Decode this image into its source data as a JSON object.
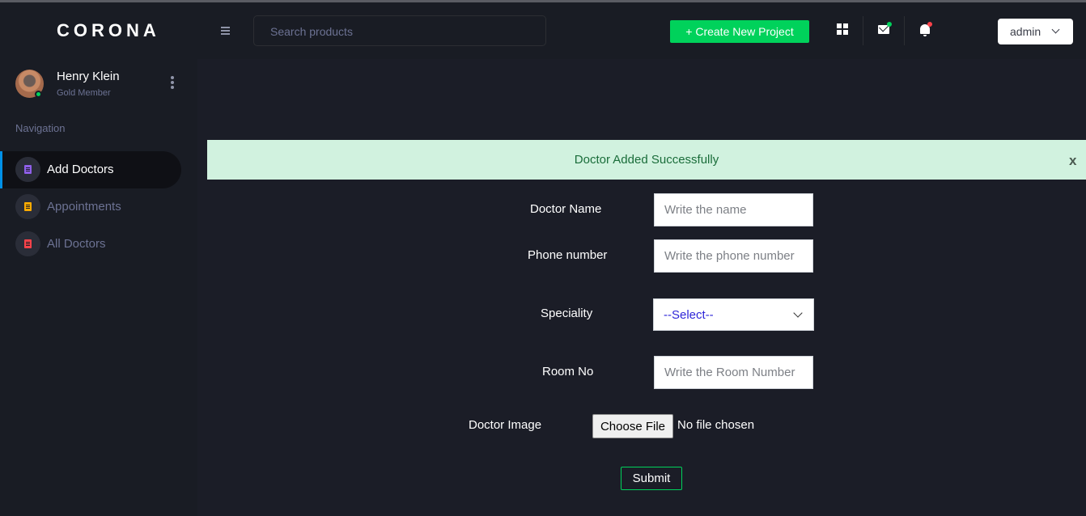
{
  "brand": "CORONA",
  "profile": {
    "name": "Henry Klein",
    "role": "Gold Member"
  },
  "sidebar": {
    "heading": "Navigation",
    "items": [
      {
        "label": "Add Doctors",
        "icon": "document-icon",
        "icon_color": "#8f5fe8",
        "active": true
      },
      {
        "label": "Appointments",
        "icon": "document-icon",
        "icon_color": "#ffab00",
        "active": false
      },
      {
        "label": "All Doctors",
        "icon": "document-icon",
        "icon_color": "#fc424a",
        "active": false
      }
    ]
  },
  "header": {
    "search_placeholder": "Search products",
    "create_button": "+ Create New Project",
    "user_menu": "admin"
  },
  "alert": {
    "message": "Doctor Added Successfully",
    "close": "x"
  },
  "form": {
    "doctor_name": {
      "label": "Doctor Name",
      "placeholder": "Write the name"
    },
    "phone": {
      "label": "Phone number",
      "placeholder": "Write the phone number"
    },
    "speciality": {
      "label": "Speciality",
      "selected": "--Select--"
    },
    "room": {
      "label": "Room No",
      "placeholder": "Write the Room Number"
    },
    "image": {
      "label": "Doctor Image",
      "button": "Choose File",
      "status": "No file chosen"
    },
    "submit": "Submit"
  },
  "colors": {
    "accent_green": "#00d25b",
    "active_bar": "#0090e7",
    "alert_bg": "#d1f2df",
    "alert_text": "#1a6d3a"
  }
}
